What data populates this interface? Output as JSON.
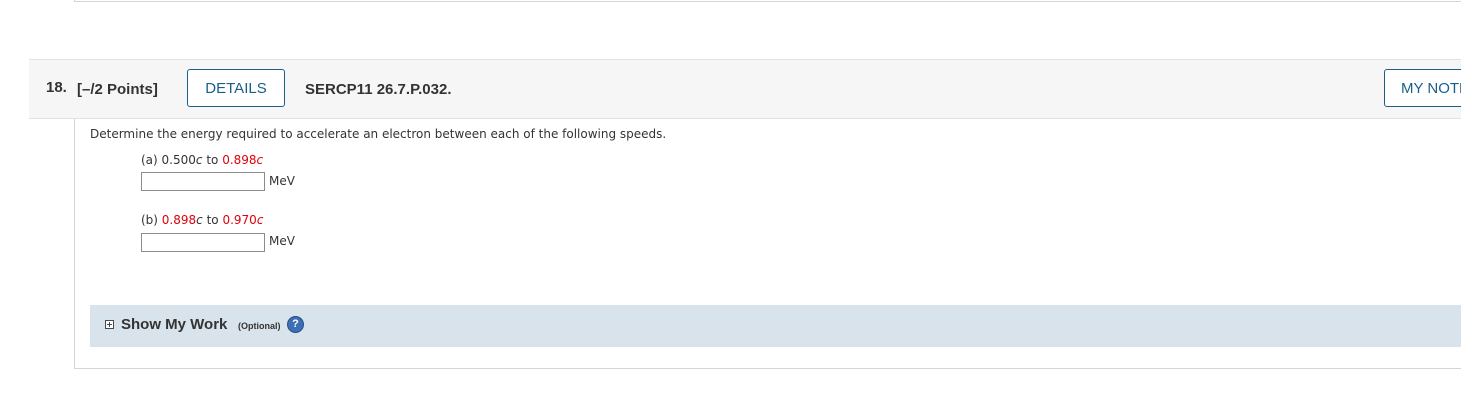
{
  "question": {
    "number": "18.",
    "points": "[–/2 Points]",
    "details_label": "DETAILS",
    "code": "SERCP11 26.7.P.032.",
    "notes_label": "MY NOTES"
  },
  "body": {
    "prompt": "Determine the energy required to accelerate an electron between each of the following speeds.",
    "parts": [
      {
        "label_prefix": "(a) ",
        "from_value": "0.500",
        "from_unit": "c",
        "connector": " to ",
        "to_value": "0.898",
        "to_unit": "c",
        "answer_value": "",
        "unit": "MeV"
      },
      {
        "label_prefix": "(b) ",
        "from_value": "0.898",
        "from_unit": "c",
        "connector": " to ",
        "to_value": "0.970",
        "to_unit": "c",
        "answer_value": "",
        "unit": "MeV"
      }
    ]
  },
  "show_work": {
    "title": "Show My Work",
    "optional": "(Optional)",
    "help_glyph": "?",
    "expand_icon": "plus-box-icon",
    "help_icon": "question-circle-icon"
  },
  "colors": {
    "highlight_red": "#e0000a",
    "button_blue": "#1a5f8a",
    "work_bar_bg": "#d9e3ec"
  }
}
